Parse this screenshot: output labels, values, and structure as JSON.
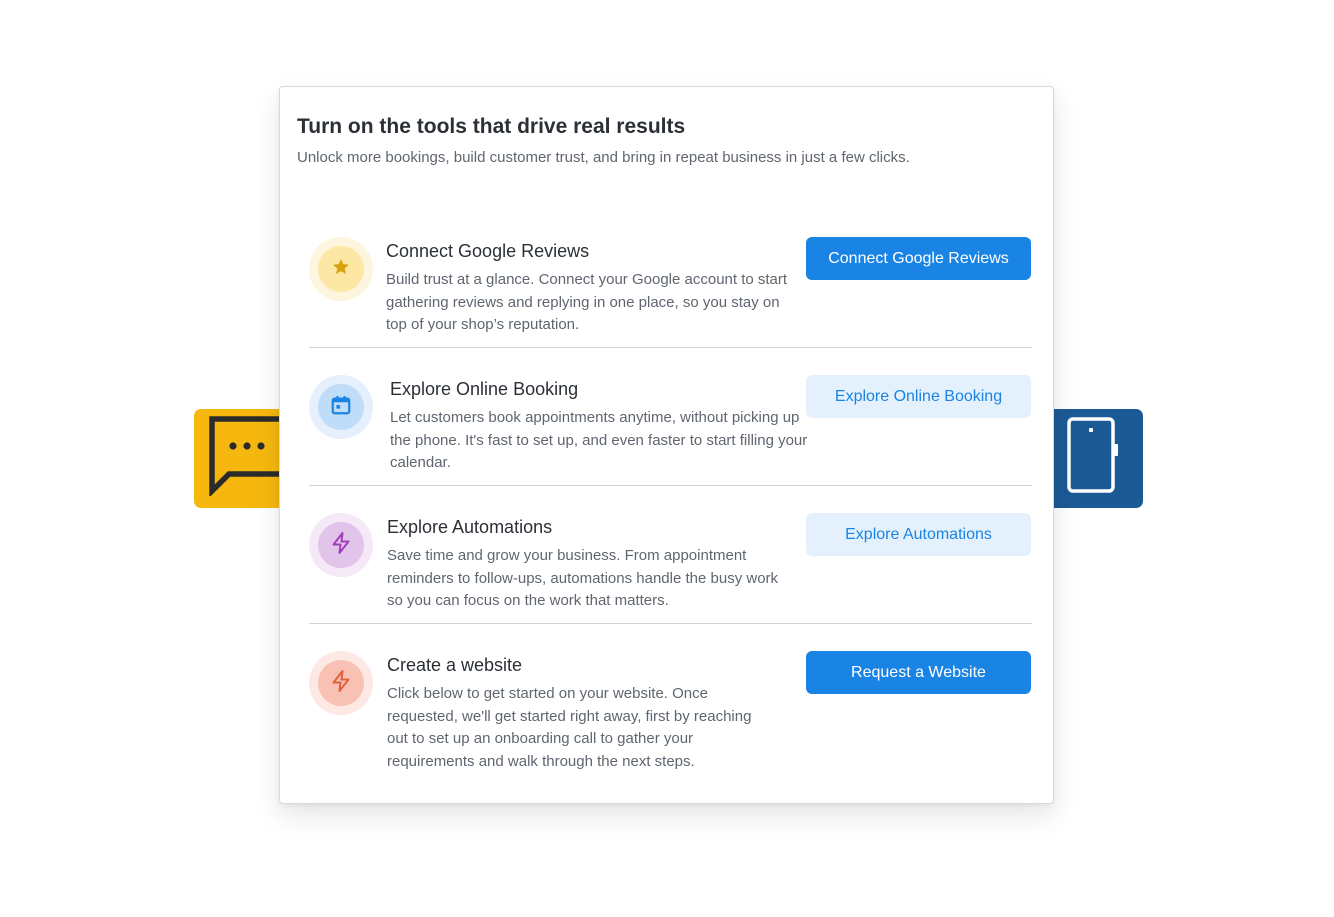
{
  "card": {
    "title": "Turn on the tools that drive real results",
    "subtitle": "Unlock more bookings, build customer trust, and bring in repeat business in just a few clicks."
  },
  "items": [
    {
      "icon": "star-icon",
      "title": "Connect Google Reviews",
      "description": "Build trust at a glance. Connect your Google account to start gathering reviews and replying in one place, so you stay on top of your shop’s reputation.",
      "button_label": "Connect Google Reviews",
      "button_style": "primary"
    },
    {
      "icon": "calendar-icon",
      "title": "Explore Online Booking",
      "description": "Let customers book appointments anytime, without picking up the phone. It's fast to set up, and even faster to start filling your calendar.",
      "button_label": "Explore Online Booking",
      "button_style": "secondary"
    },
    {
      "icon": "lightning-icon",
      "title": "Explore Automations",
      "description": "Save time and grow your business. From appointment reminders to follow-ups, automations handle the busy work so you can focus on the work that matters.",
      "button_label": "Explore Automations",
      "button_style": "secondary"
    },
    {
      "icon": "lightning-icon",
      "title": "Create a website",
      "description": "Click below to get started on your website. Once requested, we'll get started right away, first by reaching out to set up an onboarding call to gather your requirements and walk through the next steps.",
      "button_label": "Request a Website",
      "button_style": "primary"
    }
  ],
  "decorations": {
    "left_tile_icon": "chat-bubble-icon",
    "right_tile_icon": "mobile-phone-icon"
  },
  "colors": {
    "primary": "#1a84e4",
    "primary_light": "#e4f1fd",
    "chat_tile": "#f6b80f",
    "phone_tile": "#1c5a96"
  }
}
